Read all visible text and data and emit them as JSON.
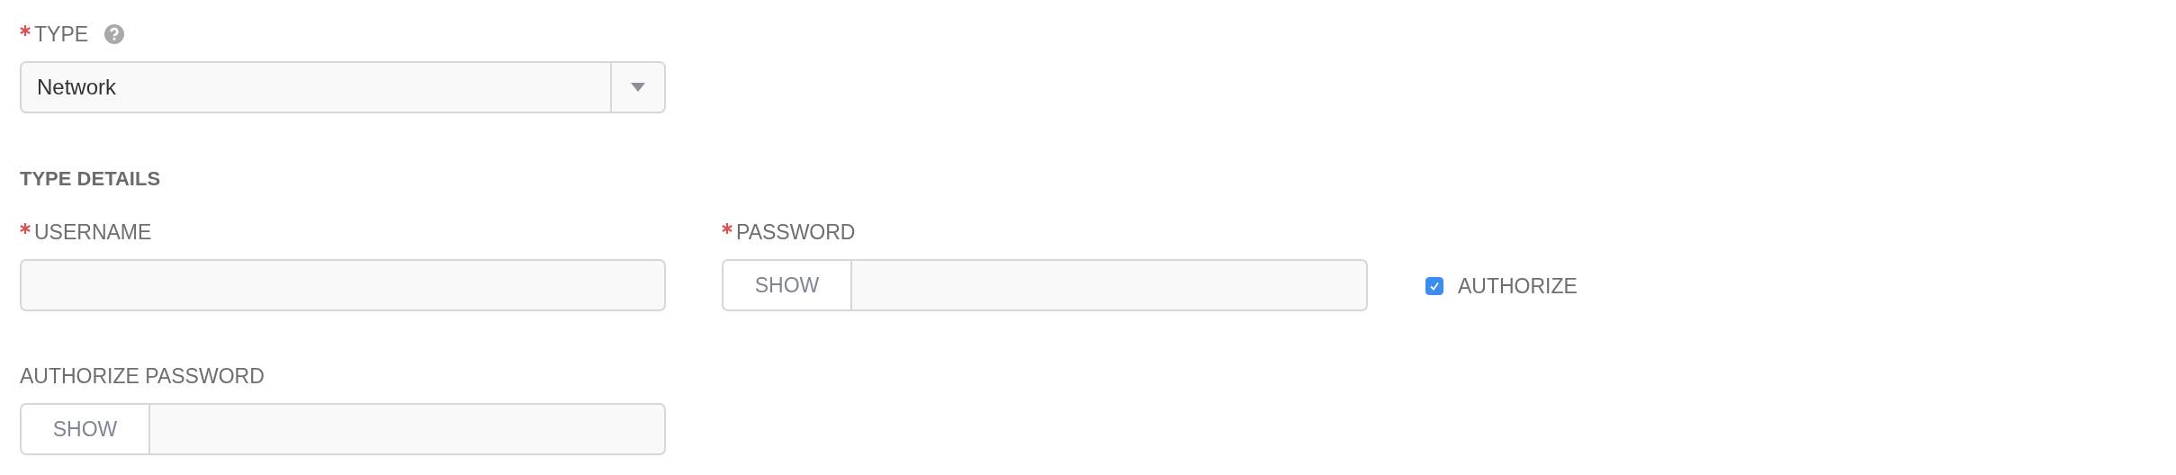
{
  "type_field": {
    "label": "TYPE",
    "required": true,
    "value": "Network"
  },
  "section_title": "TYPE DETAILS",
  "fields": [
    {
      "kind": "text",
      "label": "USERNAME",
      "required": true
    },
    {
      "kind": "password",
      "label": "PASSWORD",
      "required": true,
      "button": "SHOW"
    },
    {
      "kind": "checkbox",
      "label": "AUTHORIZE",
      "checked": true
    },
    {
      "kind": "password",
      "label": "AUTHORIZE PASSWORD",
      "required": false,
      "button": "SHOW"
    }
  ]
}
